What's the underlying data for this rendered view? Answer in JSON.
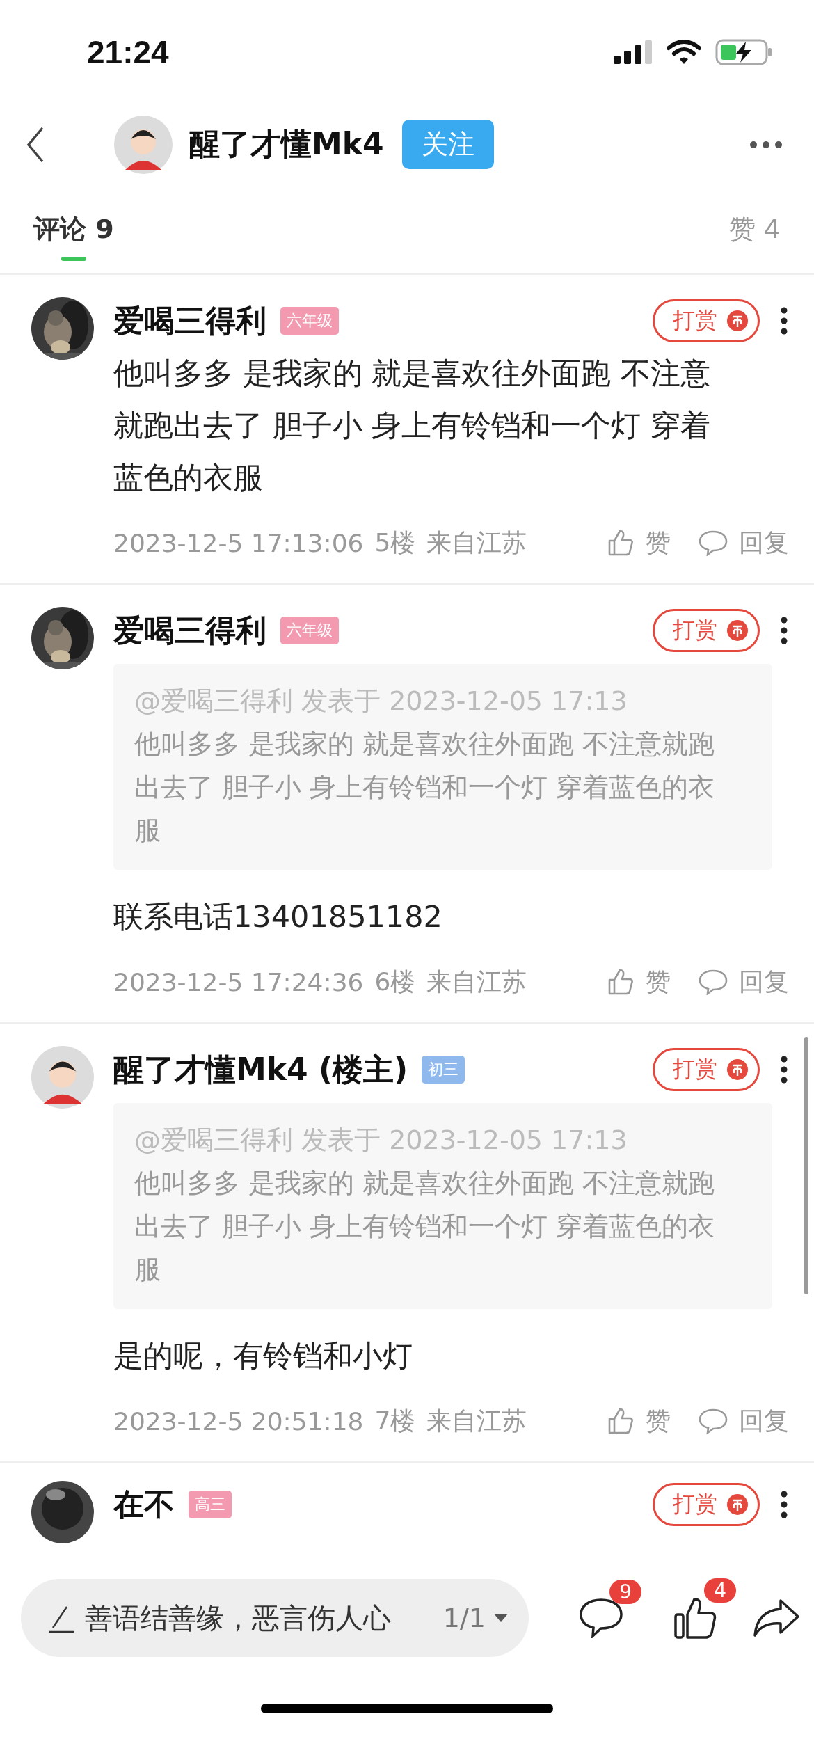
{
  "status_bar": {
    "time": "21:24"
  },
  "header": {
    "user_name": "醒了才懂Mk4",
    "follow_button": "关注"
  },
  "tabs": [
    {
      "label": "评论",
      "count": "9",
      "selected": true
    },
    {
      "label": "赞",
      "count": "4",
      "selected": false
    }
  ],
  "comments": [
    {
      "name": "爱喝三得利",
      "badge": {
        "label": "六年级",
        "color": "#f49ab0"
      },
      "reward": "打赏",
      "text": "他叫多多 是我家的 就是喜欢往外面跑 不注意就跑出去了 胆子小 身上有铃铛和一个灯 穿着蓝色的衣服",
      "time": "2023-12-5 17:13:06",
      "floor": "5楼",
      "location": "来自江苏",
      "like": "赞",
      "reply": "回复"
    },
    {
      "name": "爱喝三得利",
      "badge": {
        "label": "六年级",
        "color": "#f49ab0"
      },
      "reward": "打赏",
      "quote": {
        "mention": "@爱喝三得利 发表于 2023-12-05 17:13",
        "text": "他叫多多 是我家的 就是喜欢往外面跑 不注意就跑出去了 胆子小 身上有铃铛和一个灯 穿着蓝色的衣服"
      },
      "text": "联系电话13401851182",
      "time": "2023-12-5 17:24:36",
      "floor": "6楼",
      "location": "来自江苏",
      "like": "赞",
      "reply": "回复"
    },
    {
      "avatar": {
        "kind": "figure"
      },
      "name": "醒了才懂Mk4 (楼主)",
      "badge": {
        "label": "初三",
        "color": "#8fb8ec"
      },
      "reward": "打赏",
      "quote": {
        "mention": "@爱喝三得利 发表于 2023-12-05 17:13",
        "text": "他叫多多 是我家的 就是喜欢往外面跑 不注意就跑出去了 胆子小 身上有铃铛和一个灯 穿着蓝色的衣服"
      },
      "text": "是的呢，有铃铛和小灯",
      "time": "2023-12-5 20:51:18",
      "floor": "7楼",
      "location": "来自江苏",
      "like": "赞",
      "reply": "回复"
    }
  ],
  "partial_comment": {
    "name": "在不",
    "badge": {
      "label": "高三",
      "color": "#f49ab0"
    },
    "reward": "打赏"
  },
  "bottom_bar": {
    "placeholder": "善语结善缘，恶言伤人心",
    "page": "1/1",
    "comment_count": "9",
    "like_count": "4"
  }
}
